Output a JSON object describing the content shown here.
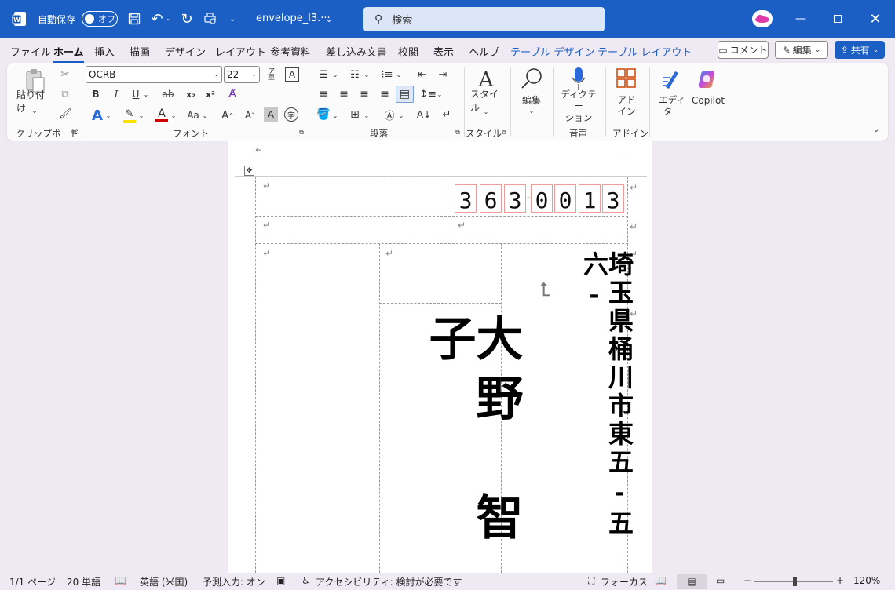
{
  "titlebar": {
    "autosave_label": "自動保存",
    "autosave_state": "オフ",
    "filename": "envelope_l3.···",
    "search_placeholder": "検索"
  },
  "menu": {
    "items": [
      "ファイル",
      "ホーム",
      "挿入",
      "描画",
      "デザイン",
      "レイアウト",
      "参考資料",
      "差し込み文書",
      "校閲",
      "表示",
      "ヘルプ",
      "テーブル デザイン",
      "テーブル レイアウト"
    ],
    "comment_button": "コメント",
    "edit_button": "編集",
    "share_button": "共有"
  },
  "ribbon": {
    "paste_label": "貼り付け",
    "clipboard_group": "クリップボード",
    "font_name": "OCRB",
    "font_size": "22",
    "font_group": "フォント",
    "paragraph_group": "段落",
    "style_label": "スタイル",
    "style_group": "スタイル",
    "edit_label": "編集",
    "dictate_label": "ディクテー\nション",
    "voice_group": "音声",
    "addin_label": "アド\nイン",
    "addin_group": "アドイン",
    "editor_label": "エディ\nター",
    "copilot_label": "Copilot",
    "bold": "B",
    "italic": "I",
    "underline": "U",
    "strike": "ab",
    "subscript": "x₂",
    "superscript": "x²",
    "case_label": "Aa",
    "grow_font": "A^",
    "shrink_font": "Aˇ",
    "furigana": "ア亜"
  },
  "envelope": {
    "zip_digits": [
      "3",
      "6",
      "3",
      "0",
      "0",
      "1",
      "3"
    ],
    "recipient_name": "大野　智子",
    "address": "埼玉県桶川市東五-五六-"
  },
  "status": {
    "page": "1/1 ページ",
    "words": "20 単語",
    "language": "英語 (米国)",
    "predict": "予測入力: オン",
    "accessibility": "アクセシビリティ: 検討が必要です",
    "focus": "フォーカス",
    "zoom": "120%"
  },
  "colors": {
    "title_blue": "#1b5fc4",
    "highlight_yellow": "#ffe100",
    "font_red": "#d00000",
    "zip_border": "#f09a9a"
  }
}
